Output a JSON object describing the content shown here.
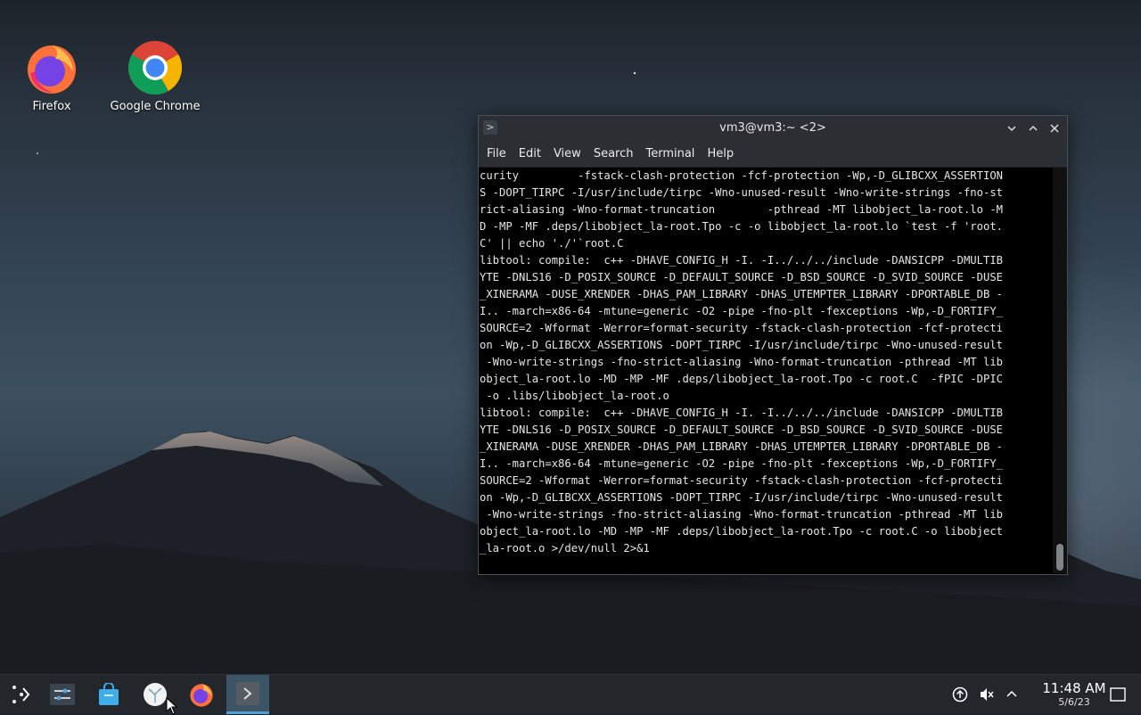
{
  "desktop": {
    "icons": [
      {
        "label": "Firefox"
      },
      {
        "label": "Google Chrome"
      }
    ]
  },
  "terminal": {
    "title": "vm3@vm3:~ <2>",
    "menu": [
      "File",
      "Edit",
      "View",
      "Search",
      "Terminal",
      "Help"
    ],
    "lines": [
      "curity         -fstack-clash-protection -fcf-protection -Wp,-D_GLIBCXX_ASSERTION",
      "S -DOPT_TIRPC -I/usr/include/tirpc -Wno-unused-result -Wno-write-strings -fno-st",
      "rict-aliasing -Wno-format-truncation        -pthread -MT libobject_la-root.lo -M",
      "D -MP -MF .deps/libobject_la-root.Tpo -c -o libobject_la-root.lo `test -f 'root.",
      "C' || echo './'`root.C",
      "libtool: compile:  c++ -DHAVE_CONFIG_H -I. -I../../../include -DANSICPP -DMULTIB",
      "YTE -DNLS16 -D_POSIX_SOURCE -D_DEFAULT_SOURCE -D_BSD_SOURCE -D_SVID_SOURCE -DUSE",
      "_XINERAMA -DUSE_XRENDER -DHAS_PAM_LIBRARY -DHAS_UTEMPTER_LIBRARY -DPORTABLE_DB -",
      "I.. -march=x86-64 -mtune=generic -O2 -pipe -fno-plt -fexceptions -Wp,-D_FORTIFY_",
      "SOURCE=2 -Wformat -Werror=format-security -fstack-clash-protection -fcf-protecti",
      "on -Wp,-D_GLIBCXX_ASSERTIONS -DOPT_TIRPC -I/usr/include/tirpc -Wno-unused-result",
      " -Wno-write-strings -fno-strict-aliasing -Wno-format-truncation -pthread -MT lib",
      "object_la-root.lo -MD -MP -MF .deps/libobject_la-root.Tpo -c root.C  -fPIC -DPIC",
      " -o .libs/libobject_la-root.o",
      "libtool: compile:  c++ -DHAVE_CONFIG_H -I. -I../../../include -DANSICPP -DMULTIB",
      "YTE -DNLS16 -D_POSIX_SOURCE -D_DEFAULT_SOURCE -D_BSD_SOURCE -D_SVID_SOURCE -DUSE",
      "_XINERAMA -DUSE_XRENDER -DHAS_PAM_LIBRARY -DHAS_UTEMPTER_LIBRARY -DPORTABLE_DB -",
      "I.. -march=x86-64 -mtune=generic -O2 -pipe -fno-plt -fexceptions -Wp,-D_FORTIFY_",
      "SOURCE=2 -Wformat -Werror=format-security -fstack-clash-protection -fcf-protecti",
      "on -Wp,-D_GLIBCXX_ASSERTIONS -DOPT_TIRPC -I/usr/include/tirpc -Wno-unused-result",
      " -Wno-write-strings -fno-strict-aliasing -Wno-format-truncation -pthread -MT lib",
      "object_la-root.lo -MD -MP -MF .deps/libobject_la-root.Tpo -c root.C -o libobject",
      "_la-root.o >/dev/null 2>&1"
    ]
  },
  "taskbar": {
    "clock": {
      "time": "11:48 AM",
      "date": "5/6/23"
    }
  },
  "colors": {
    "accent": "#4fa0d6",
    "taskbar_bg": "#23272b",
    "titlebar_bg": "#2b2e32"
  }
}
